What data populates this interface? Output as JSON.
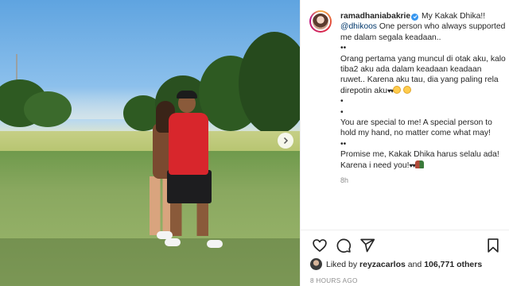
{
  "post": {
    "author": "ramadhaniabakrie",
    "caption_lines": [
      {
        "pre": " My Kakak Dhika!! ",
        "mention": "@dhikoos",
        "post": " One person who always supported me dalam segala keadaan.."
      },
      {
        "text": "••"
      },
      {
        "text": "Orang pertama yang muncul di otak aku, kalo tiba2 aku ada dalam keadaan keadaan ruwet.. Karena aku tau, dia yang paling rela direpotin aku"
      },
      {
        "text": "•"
      },
      {
        "text": "•"
      },
      {
        "text": "You are special to me! A special person to hold my hand, no matter come what may!"
      },
      {
        "text": "••"
      },
      {
        "text": "Promise me, Kakak Dhika harus selalu ada! Karena i need you!"
      }
    ],
    "relative_time": "8h",
    "liked_by_user": "reyzacarlos",
    "likes_prefix": "Liked by",
    "likes_and": "and",
    "likes_count": "106,771 others",
    "time_ago": "8 HOURS AGO"
  },
  "icons": {
    "like": "heart-outline-icon",
    "comment": "comment-bubble-icon",
    "share": "paper-plane-icon",
    "save": "bookmark-icon",
    "next": "chevron-right-icon",
    "verified": "verified-badge-icon"
  },
  "colors": {
    "verified": "#3897f0",
    "mention": "#00376b",
    "muted": "#8e8e8e"
  }
}
